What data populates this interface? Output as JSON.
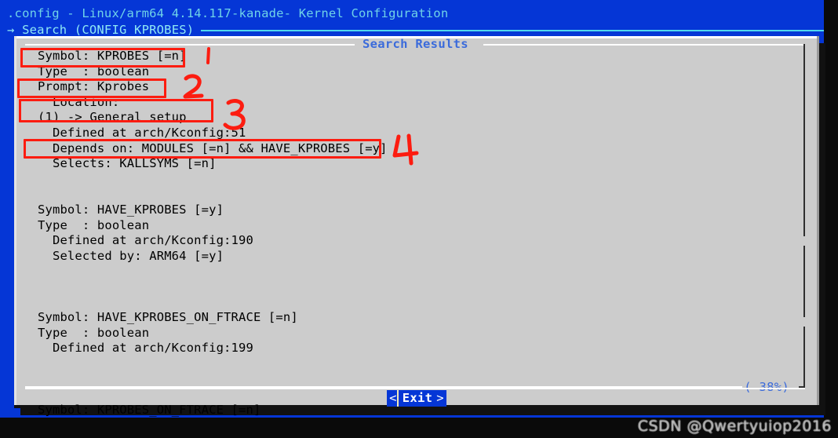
{
  "header": {
    "title": ".config - Linux/arm64 4.14.117-kanade- Kernel Configuration",
    "breadcrumb": "→ Search (CONFIG_KPROBES)"
  },
  "dialog": {
    "frame_title": "Search Results",
    "scroll_percent": "( 38%)",
    "lines": [
      "Symbol: KPROBES [=n]",
      "Type  : boolean",
      "Prompt: Kprobes",
      "  Location:",
      "(1) -> General setup",
      "  Defined at arch/Kconfig:51",
      "  Depends on: MODULES [=n] && HAVE_KPROBES [=y]",
      "  Selects: KALLSYMS [=n]",
      "",
      "",
      "Symbol: HAVE_KPROBES [=y]",
      "Type  : boolean",
      "  Defined at arch/Kconfig:190",
      "  Selected by: ARM64 [=y]",
      "",
      "",
      "",
      "Symbol: HAVE_KPROBES_ON_FTRACE [=n]",
      "Type  : boolean",
      "  Defined at arch/Kconfig:199",
      "",
      "",
      "",
      "Symbol: KPROBES_ON_FTRACE [=n]"
    ],
    "exit_button": {
      "left_bracket": "<",
      "label": "Exit",
      "right_bracket": ">"
    }
  },
  "annotations": {
    "numbers": [
      "1",
      "2",
      "3",
      "4"
    ],
    "color": "#fc1c10",
    "boxes": [
      {
        "label": "symbol-kprobes",
        "target": "Symbol: KPROBES [=n]"
      },
      {
        "label": "prompt-kprobes",
        "target": "Prompt: Kprobes"
      },
      {
        "label": "location-general-setup",
        "target": "Location: (1) -> General setup"
      },
      {
        "label": "depends-on",
        "target": "Depends on: MODULES [=n] && HAVE_KPROBES [=y]"
      }
    ]
  },
  "watermark": {
    "text": "CSDN @Qwertyuiop2016"
  },
  "colors": {
    "backdrop_blue": "#0536d6",
    "dialog_gray": "#cccccc",
    "title_cyan": "#6fd3e8",
    "accent_blue": "#3b6bdb",
    "annotation_red": "#fc1c10"
  }
}
